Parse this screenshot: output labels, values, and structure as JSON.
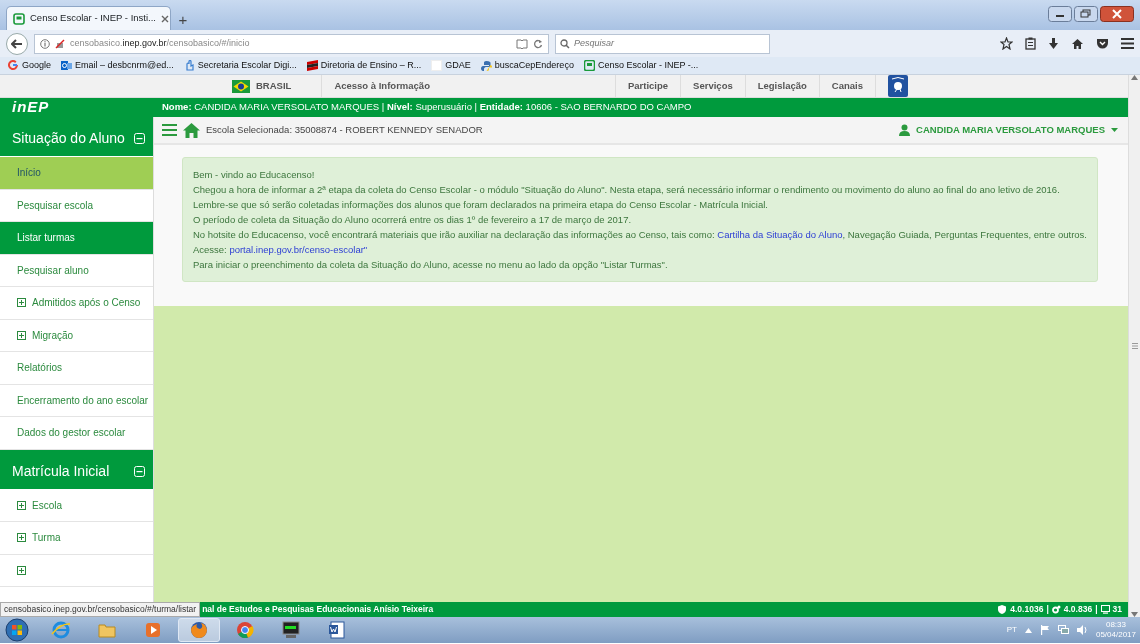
{
  "browser": {
    "tab": {
      "title": "Censo Escolar - INEP - Insti..."
    },
    "new_tab": "+",
    "address": {
      "host_pre": "censobasico.",
      "host": "inep.gov.br",
      "path": "/censobasico/#/inicio"
    },
    "search": {
      "placeholder": "Pesquisar"
    },
    "bookmarks": [
      {
        "kind": "google",
        "label": "Google"
      },
      {
        "kind": "outlook",
        "label": "Email – desbcnrm@ed..."
      },
      {
        "kind": "hand",
        "label": "Secretaria Escolar Digi..."
      },
      {
        "kind": "flag",
        "label": "Diretoria de Ensino – R..."
      },
      {
        "kind": "blank",
        "label": "GDAE"
      },
      {
        "kind": "python",
        "label": "buscaCepEndereço"
      },
      {
        "kind": "censo",
        "label": "Censo Escolar - INEP -..."
      }
    ]
  },
  "gov_bar": {
    "brand": "BRASIL",
    "access": "Acesso à Informação",
    "links": [
      "Participe",
      "Serviços",
      "Legislação",
      "Canais"
    ]
  },
  "header": {
    "logo": "inEP",
    "user_info": "**Nome:** CANDIDA MARIA VERSOLATO MARQUES | **Nível:** Superusuário | **Entidade:** 10606 - SAO BERNARDO DO CAMPO"
  },
  "topbar": {
    "school": "Escola Selecionada: 35008874 - ROBERT KENNEDY SENADOR",
    "user": "CANDIDA MARIA VERSOLATO MARQUES"
  },
  "sidebar": {
    "sections": [
      {
        "title": "Situação do Aluno",
        "expanded": true,
        "items": [
          {
            "label": "Início",
            "selected": true,
            "hovered": false,
            "expandable": false
          },
          {
            "label": "Pesquisar escola",
            "selected": false,
            "hovered": false,
            "expandable": false
          },
          {
            "label": "Listar turmas",
            "selected": false,
            "hovered": true,
            "expandable": false
          },
          {
            "label": "Pesquisar aluno",
            "selected": false,
            "hovered": false,
            "expandable": false
          },
          {
            "label": "Admitidos após o Censo",
            "selected": false,
            "hovered": false,
            "expandable": true
          },
          {
            "label": "Migração",
            "selected": false,
            "hovered": false,
            "expandable": true
          },
          {
            "label": "Relatórios",
            "selected": false,
            "hovered": false,
            "expandable": false
          },
          {
            "label": "Encerramento do ano escolar",
            "selected": false,
            "hovered": false,
            "expandable": false
          },
          {
            "label": "Dados do gestor escolar",
            "selected": false,
            "hovered": false,
            "expandable": false
          }
        ]
      },
      {
        "title": "Matrícula Inicial",
        "expanded": true,
        "items": [
          {
            "label": "Escola",
            "selected": false,
            "hovered": false,
            "expandable": true
          },
          {
            "label": "Turma",
            "selected": false,
            "hovered": false,
            "expandable": true
          },
          {
            "selected": false,
            "hovered": false,
            "expandable": true
          }
        ]
      }
    ]
  },
  "message": {
    "lines": [
      [
        {
          "text": "Bem - vindo ao Educacenso!"
        }
      ],
      [
        {
          "text": "Chegou a hora de informar a 2ª etapa da coleta do Censo Escolar - o módulo \"Situação do Aluno\". Nesta etapa, será necessário informar o rendimento ou movimento do aluno ao final do ano letivo de 2016."
        }
      ],
      [
        {
          "text": "Lembre-se que só serão coletadas informações dos alunos que foram declarados na primeira etapa do Censo Escolar - Matrícula Inicial."
        }
      ],
      [
        {
          "text": "O período de coleta da Situação do Aluno ocorrerá entre os dias 1º de fevereiro a 17 de março de 2017."
        }
      ],
      [
        {
          "text": "No hotsite do Educacenso, você encontrará materiais que irão auxiliar na declaração das informações ao Censo, tais como: "
        },
        {
          "text": "Cartilha da Situação do Aluno",
          "link": true
        },
        {
          "text": ", Navegação Guiada, Perguntas Frequentes, entre outros."
        }
      ],
      [
        {
          "text": "Acesse: "
        },
        {
          "text": "portal.inep.gov.br/censo-escolar\"",
          "link": true
        }
      ],
      [
        {
          "text": "Para iniciar o preenchimento da coleta da Situação do Aluno, acesse no menu ao lado da opção \"Listar Turmas\"."
        }
      ]
    ]
  },
  "footer": {
    "separator": "|",
    "text": "nal de Estudos e Pesquisas Educacionais Anísio Teixeira",
    "versions": [
      {
        "kind": "shield",
        "text": "4.0.1036"
      },
      {
        "kind": "gears",
        "text": "4.0.836"
      },
      {
        "kind": "monitor",
        "text": "31"
      }
    ]
  },
  "status_url": "censobasico.inep.gov.br/censobasico/#/turma/listar",
  "taskbar": {
    "apps": [
      {
        "kind": "ie",
        "active": false
      },
      {
        "kind": "folder",
        "active": false
      },
      {
        "kind": "media",
        "active": false
      },
      {
        "kind": "firefox",
        "active": true
      },
      {
        "kind": "chrome",
        "active": false
      },
      {
        "kind": "terminal",
        "active": false
      },
      {
        "kind": "word",
        "active": false
      }
    ],
    "lang": "PT",
    "time": "08:33",
    "date": "05/04/2017"
  }
}
